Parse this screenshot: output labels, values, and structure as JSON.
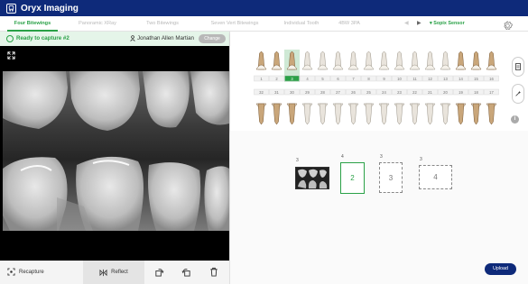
{
  "app": {
    "title": "Oryx Imaging"
  },
  "tabs": [
    {
      "label": "Four Bitewings",
      "active": true
    },
    {
      "label": "Panoramic XRay",
      "active": false
    },
    {
      "label": "Two Bitewings",
      "active": false
    },
    {
      "label": "Seven Vert Bitewings",
      "active": false
    },
    {
      "label": "Individual Tooth",
      "active": false
    },
    {
      "label": "4BW 3PA",
      "active": false
    }
  ],
  "sensor": {
    "label": "Sopix Sensor"
  },
  "status": {
    "text": "Ready to capture #2",
    "patient_name": "Jonathan Allen Martian",
    "change_label": "Change"
  },
  "tooth_chart": {
    "upper_numbers": [
      "1",
      "2",
      "3",
      "4",
      "5",
      "6",
      "7",
      "8",
      "9",
      "10",
      "11",
      "12",
      "13",
      "14",
      "15",
      "16"
    ],
    "lower_numbers": [
      "32",
      "31",
      "30",
      "29",
      "28",
      "27",
      "26",
      "25",
      "24",
      "23",
      "22",
      "21",
      "20",
      "19",
      "18",
      "17"
    ],
    "highlighted_tooth": "3",
    "captured_teeth": [
      "1",
      "2",
      "3",
      "14",
      "15",
      "16",
      "17",
      "18",
      "19",
      "30",
      "31",
      "32"
    ]
  },
  "slots": [
    {
      "label": "3",
      "state": "captured",
      "value": ""
    },
    {
      "label": "4",
      "state": "active",
      "value": "2"
    },
    {
      "label": "3",
      "state": "pending",
      "value": "3"
    },
    {
      "label": "3",
      "state": "pending",
      "value": "4"
    }
  ],
  "actions": {
    "recapture_label": "Recapture",
    "reflect_label": "Reflect",
    "upload_label": "Upload"
  },
  "colors": {
    "brand": "#0e2a7a",
    "accent": "#2aa147",
    "status_bg": "#e5f5e9"
  },
  "icons": {
    "logo": "tooth-logo-icon",
    "settings": "gear-icon",
    "expand": "expand-icon",
    "recapture": "capture-icon",
    "reflect": "reflect-icon",
    "rotate_right": "rotate-right-icon",
    "rotate_left": "rotate-left-icon",
    "delete": "trash-icon"
  }
}
